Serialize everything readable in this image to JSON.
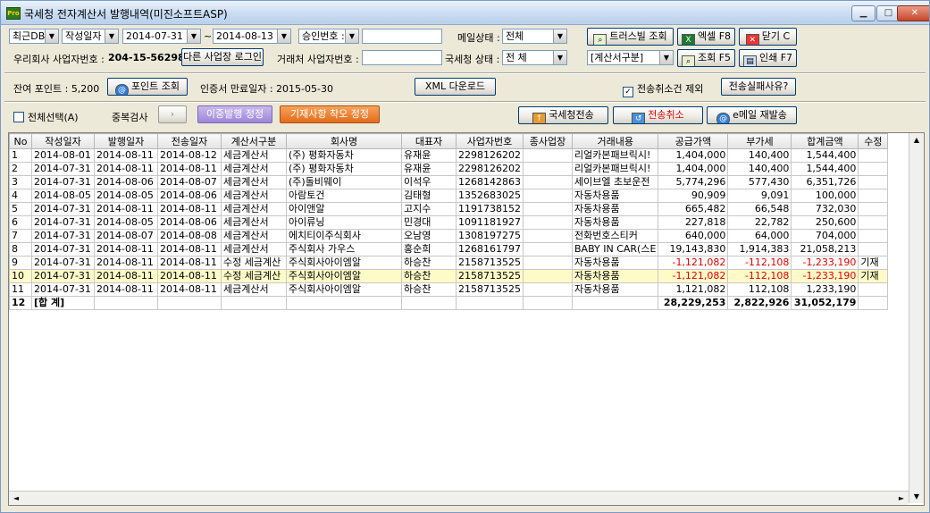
{
  "window": {
    "title": "국세청 전자계산서 발행내역(미진소프트ASP)",
    "app_icon": "Pro"
  },
  "filters": {
    "db": "최근DB",
    "date_type": "작성일자",
    "date_from": "2014-07-31",
    "tilde": "~",
    "date_to": "2014-08-13",
    "approval_label": "승인번호 :",
    "mail_status_label": "메일상태 :",
    "mail_status": "전체",
    "our_biz_label": "우리회사 사업자번호 :",
    "our_biz_no": "204-15-56298",
    "other_login": "다른 사업장 로그인",
    "partner_biz_label": "거래처 사업자번호 :",
    "nts_status_label": "국세청 상태 :",
    "nts_status": "전       체",
    "invoice_type": "[계산서구분]"
  },
  "buttons": {
    "trusbill": "트러스빌 조회",
    "excel": "엑셀 F8",
    "close": "닫기 C",
    "search": "조회 F5",
    "print": "인쇄 F7",
    "point_query": "포인트 조회",
    "xml_download": "XML 다운로드",
    "fail_reason": "전송실패사유?",
    "dup_check": "중복검사",
    "dup_issue": "이중발행 정정",
    "entry_error": "기재사항 착오 정정",
    "nts_send": "국세청전송",
    "cancel_send": "전송취소",
    "email_resend": "e메일 재발송"
  },
  "info": {
    "points_label": "잔여 포인트 :",
    "points": "5,200",
    "cert_label": "인증서 만료일자 :",
    "cert_date": "2015-05-30",
    "exclude_cancel": "전송취소건 제외",
    "select_all": "전체선택(A)"
  },
  "table": {
    "headers": [
      "No",
      "작성일자",
      "발행일자",
      "전송일자",
      "계산서구분",
      "회사명",
      "대표자",
      "사업자번호",
      "종사업장",
      "거래내용",
      "공급가액",
      "부가세",
      "합계금액",
      "수정"
    ],
    "rows": [
      [
        "1",
        "2014-08-01",
        "2014-08-11",
        "2014-08-12",
        "세금계산서",
        "(주) 평화자동차",
        "유재윤",
        "2298126202",
        "",
        "리얼카본패브릭시!",
        "1,404,000",
        "140,400",
        "1,544,400",
        ""
      ],
      [
        "2",
        "2014-07-31",
        "2014-08-11",
        "2014-08-11",
        "세금계산서",
        "(주) 평화자동차",
        "유재윤",
        "2298126202",
        "",
        "리얼카본패브릭시!",
        "1,404,000",
        "140,400",
        "1,544,400",
        ""
      ],
      [
        "3",
        "2014-07-31",
        "2014-08-06",
        "2014-08-07",
        "세금계산서",
        "(주)돌비웨이",
        "이석우",
        "1268142863",
        "",
        "세이브엘 초보운전",
        "5,774,296",
        "577,430",
        "6,351,726",
        ""
      ],
      [
        "4",
        "2014-08-05",
        "2014-08-05",
        "2014-08-06",
        "세금계산서",
        "아람토건",
        "김태형",
        "1352683025",
        "",
        "자동차용품",
        "90,909",
        "9,091",
        "100,000",
        ""
      ],
      [
        "5",
        "2014-07-31",
        "2014-08-11",
        "2014-08-11",
        "세금계산서",
        "아이앤알",
        "고지수",
        "1191738152",
        "",
        "자동차용품",
        "665,482",
        "66,548",
        "732,030",
        ""
      ],
      [
        "6",
        "2014-07-31",
        "2014-08-05",
        "2014-08-06",
        "세금계산서",
        "아이류닝",
        "민경대",
        "1091181927",
        "",
        "자동차용품",
        "227,818",
        "22,782",
        "250,600",
        ""
      ],
      [
        "7",
        "2014-07-31",
        "2014-08-07",
        "2014-08-08",
        "세금계산서",
        "에치티이주식회사",
        "오남영",
        "1308197275",
        "",
        "전화번호스티커",
        "640,000",
        "64,000",
        "704,000",
        ""
      ],
      [
        "8",
        "2014-07-31",
        "2014-08-11",
        "2014-08-11",
        "세금계산서",
        "주식회사 가우스",
        "홍순희",
        "1268161797",
        "",
        "BABY IN CAR(스E",
        "19,143,830",
        "1,914,383",
        "21,058,213",
        ""
      ],
      [
        "9",
        "2014-07-31",
        "2014-08-11",
        "2014-08-11",
        "수정 세금계산",
        "주식회사아이엠알",
        "하승찬",
        "2158713525",
        "",
        "자동차용품",
        "-1,121,082",
        "-112,108",
        "-1,233,190",
        "기재"
      ],
      [
        "10",
        "2014-07-31",
        "2014-08-11",
        "2014-08-11",
        "수정 세금계산",
        "주식회사아이엠알",
        "하승찬",
        "2158713525",
        "",
        "자동차용품",
        "-1,121,082",
        "-112,108",
        "-1,233,190",
        "기재"
      ],
      [
        "11",
        "2014-07-31",
        "2014-08-11",
        "2014-08-11",
        "세금계산서",
        "주식회사아이엠알",
        "하승찬",
        "2158713525",
        "",
        "자동차용품",
        "1,121,082",
        "112,108",
        "1,233,190",
        ""
      ]
    ],
    "total": [
      "12",
      "[합 계]",
      "",
      "",
      "",
      "",
      "",
      "",
      "",
      "",
      "28,229,253",
      "2,822,926",
      "31,052,179",
      ""
    ],
    "selected_row": 9
  }
}
